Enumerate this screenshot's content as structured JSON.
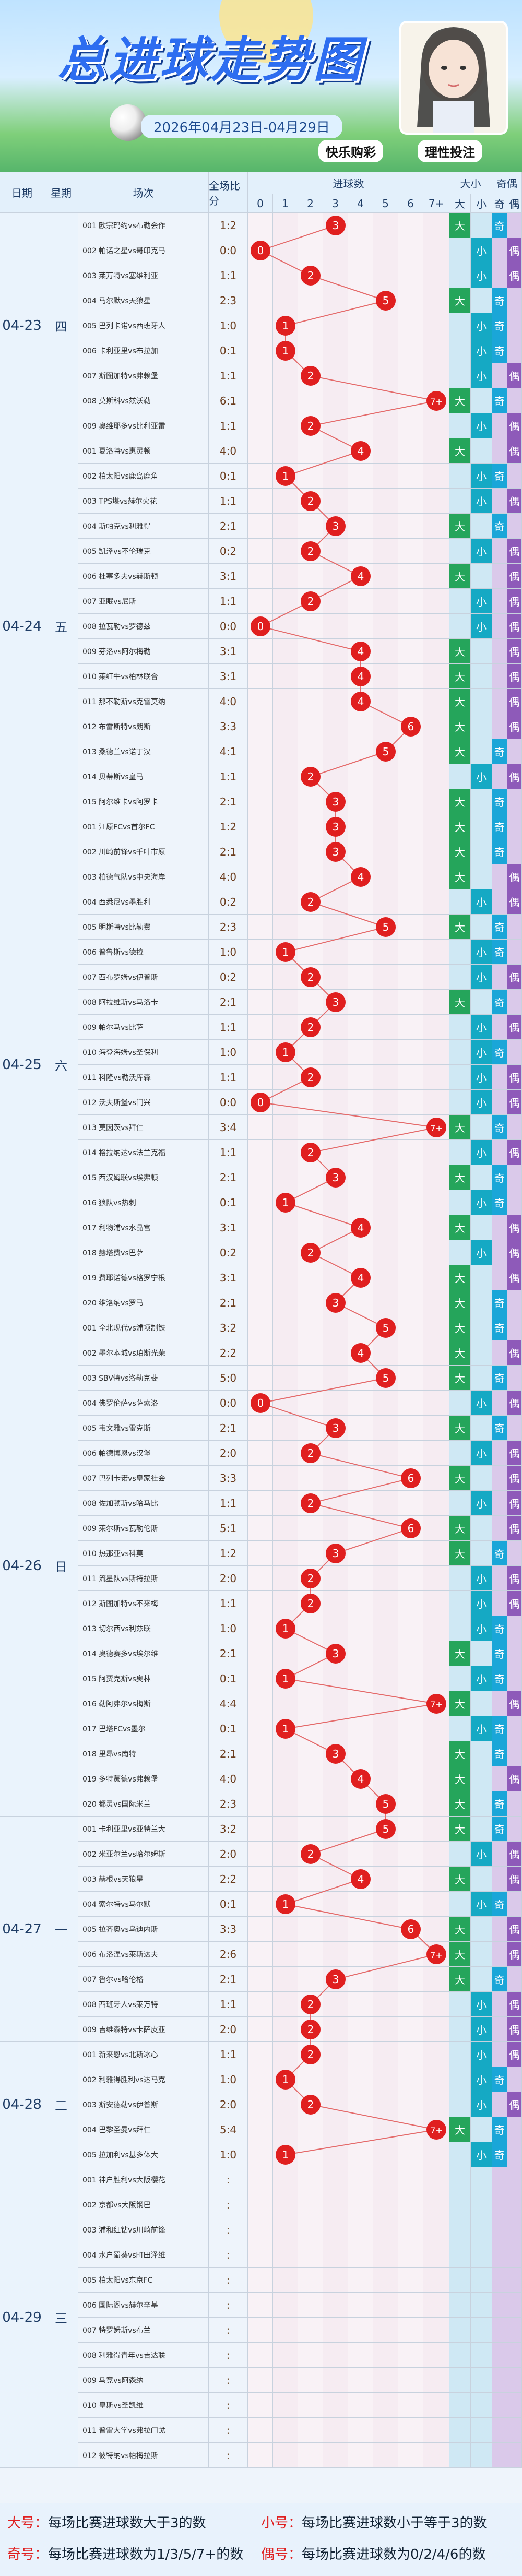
{
  "banner": {
    "title": "总进球走势图",
    "date_range": "2026年04月23日-04月29日",
    "brand_left": "快乐购彩",
    "brand_right": "理性投注",
    "colors": {
      "title": "#2d6df0",
      "ball": "#e01f1f",
      "line": "#e46a6a",
      "big": "#25a55b",
      "small": "#15a9c4",
      "odd": "#1aa6d8",
      "even": "#8e5ab9"
    }
  },
  "headers": {
    "date": "日期",
    "week": "星期",
    "match": "场次",
    "full_score": "全场比分",
    "goals": "进球数",
    "goal_cols": [
      "0",
      "1",
      "2",
      "3",
      "4",
      "5",
      "6",
      "7+"
    ],
    "bigsmall": "大小",
    "oddeven": "奇偶",
    "big": "大",
    "small": "小",
    "odd": "奇",
    "even": "偶"
  },
  "groups": [
    {
      "date": "04-23",
      "week": "四",
      "rows": 9
    },
    {
      "date": "04-24",
      "week": "五",
      "rows": 15
    },
    {
      "date": "04-25",
      "week": "六",
      "rows": 20
    },
    {
      "date": "04-26",
      "week": "日",
      "rows": 20
    },
    {
      "date": "04-27",
      "week": "一",
      "rows": 9
    },
    {
      "date": "04-28",
      "week": "二",
      "rows": 5
    },
    {
      "date": "04-29",
      "week": "三",
      "rows": 12
    }
  ],
  "chart_data": {
    "type": "table",
    "goal_categories": [
      "0",
      "1",
      "2",
      "3",
      "4",
      "5",
      "6",
      "7+"
    ],
    "matches": [
      {
        "m": "001 欧宗玛约vs布勒会作",
        "s": "1:2",
        "g": 3,
        "bs": "大",
        "oe": "奇"
      },
      {
        "m": "002 帕诺之星vs哥印克马",
        "s": "0:0",
        "g": 0,
        "bs": "小",
        "oe": "偶"
      },
      {
        "m": "003 莱万特vs塞维利亚",
        "s": "1:1",
        "g": 2,
        "bs": "小",
        "oe": "偶"
      },
      {
        "m": "004 马尔默vs天狼星",
        "s": "2:3",
        "g": 5,
        "bs": "大",
        "oe": "奇"
      },
      {
        "m": "005 巴列卡诺vs西班牙人",
        "s": "1:0",
        "g": 1,
        "bs": "小",
        "oe": "奇"
      },
      {
        "m": "006 卡利亚里vs布拉加",
        "s": "0:1",
        "g": 1,
        "bs": "小",
        "oe": "奇"
      },
      {
        "m": "007 斯图加特vs弗赖堡",
        "s": "1:1",
        "g": 2,
        "bs": "小",
        "oe": "偶"
      },
      {
        "m": "008 莫斯科vs兹沃勒",
        "s": "6:1",
        "g": 7,
        "bs": "大",
        "oe": "奇"
      },
      {
        "m": "009 奥维耶多vs比利亚雷",
        "s": "1:1",
        "g": 2,
        "bs": "小",
        "oe": "偶"
      },
      {
        "m": "001 夏洛特vs惠灵顿",
        "s": "4:0",
        "g": 4,
        "bs": "大",
        "oe": "偶"
      },
      {
        "m": "002 柏太阳vs鹿岛鹿角",
        "s": "0:1",
        "g": 1,
        "bs": "小",
        "oe": "奇"
      },
      {
        "m": "003 TPS堪vs赫尔火花",
        "s": "1:1",
        "g": 2,
        "bs": "小",
        "oe": "偶"
      },
      {
        "m": "004 斯帕克vs利雅得",
        "s": "2:1",
        "g": 3,
        "bs": "大",
        "oe": "奇"
      },
      {
        "m": "005 凯泽vs不伦瑞克",
        "s": "0:2",
        "g": 2,
        "bs": "小",
        "oe": "偶"
      },
      {
        "m": "006 杜塞多夫vs赫斯顿",
        "s": "3:1",
        "g": 4,
        "bs": "大",
        "oe": "偶"
      },
      {
        "m": "007 亚眠vs尼斯",
        "s": "1:1",
        "g": 2,
        "bs": "小",
        "oe": "偶"
      },
      {
        "m": "008 拉瓦勒vs罗德兹",
        "s": "0:0",
        "g": 0,
        "bs": "小",
        "oe": "偶"
      },
      {
        "m": "009 芬洛vs阿尔梅勒",
        "s": "3:1",
        "g": 4,
        "bs": "大",
        "oe": "偶"
      },
      {
        "m": "010 莱红牛vs柏林联合",
        "s": "3:1",
        "g": 4,
        "bs": "大",
        "oe": "偶"
      },
      {
        "m": "011 那不勒斯vs克雷莫纳",
        "s": "4:0",
        "g": 4,
        "bs": "大",
        "oe": "偶"
      },
      {
        "m": "012 布雷斯特vs朗斯",
        "s": "3:3",
        "g": 6,
        "bs": "大",
        "oe": "偶"
      },
      {
        "m": "013 桑德兰vs诺丁汉",
        "s": "4:1",
        "g": 5,
        "bs": "大",
        "oe": "奇"
      },
      {
        "m": "014 贝蒂斯vs皇马",
        "s": "1:1",
        "g": 2,
        "bs": "小",
        "oe": "偶"
      },
      {
        "m": "015 阿尔维卡vs阿罗卡",
        "s": "2:1",
        "g": 3,
        "bs": "大",
        "oe": "奇"
      },
      {
        "m": "001 江原FCvs首尔FC",
        "s": "1:2",
        "g": 3,
        "bs": "大",
        "oe": "奇"
      },
      {
        "m": "002 川崎前锋vs千叶市原",
        "s": "2:1",
        "g": 3,
        "bs": "大",
        "oe": "奇"
      },
      {
        "m": "003 柏德气队vs中央海岸",
        "s": "4:0",
        "g": 4,
        "bs": "大",
        "oe": "偶"
      },
      {
        "m": "004 西悉尼vs墨胜利",
        "s": "0:2",
        "g": 2,
        "bs": "小",
        "oe": "偶"
      },
      {
        "m": "005 明斯特vs比勒费",
        "s": "2:3",
        "g": 5,
        "bs": "大",
        "oe": "奇"
      },
      {
        "m": "006 普鲁斯vs德拉",
        "s": "1:0",
        "g": 1,
        "bs": "小",
        "oe": "奇"
      },
      {
        "m": "007 西布罗姆vs伊普斯",
        "s": "0:2",
        "g": 2,
        "bs": "小",
        "oe": "偶"
      },
      {
        "m": "008 阿拉维斯vs马洛卡",
        "s": "2:1",
        "g": 3,
        "bs": "大",
        "oe": "奇"
      },
      {
        "m": "009 帕尔马vs比萨",
        "s": "1:1",
        "g": 2,
        "bs": "小",
        "oe": "偶"
      },
      {
        "m": "010 海登海姆vs圣保利",
        "s": "1:0",
        "g": 1,
        "bs": "小",
        "oe": "奇"
      },
      {
        "m": "011 科隆vs勒沃库森",
        "s": "1:1",
        "g": 2,
        "bs": "小",
        "oe": "偶"
      },
      {
        "m": "012 沃夫斯堡vs门兴",
        "s": "0:0",
        "g": 0,
        "bs": "小",
        "oe": "偶"
      },
      {
        "m": "013 莫因茨vs拜仁",
        "s": "3:4",
        "g": 7,
        "bs": "大",
        "oe": "奇"
      },
      {
        "m": "014 格拉纳达vs法兰克福",
        "s": "1:1",
        "g": 2,
        "bs": "小",
        "oe": "偶"
      },
      {
        "m": "015 西汉姆联vs埃弗顿",
        "s": "2:1",
        "g": 3,
        "bs": "大",
        "oe": "奇"
      },
      {
        "m": "016 狼队vs热刺",
        "s": "0:1",
        "g": 1,
        "bs": "小",
        "oe": "奇"
      },
      {
        "m": "017 利物浦vs水晶宫",
        "s": "3:1",
        "g": 4,
        "bs": "大",
        "oe": "偶"
      },
      {
        "m": "018 赫塔费vs巴萨",
        "s": "0:2",
        "g": 2,
        "bs": "小",
        "oe": "偶"
      },
      {
        "m": "019 费耶诺德vs格罗宁根",
        "s": "3:1",
        "g": 4,
        "bs": "大",
        "oe": "偶"
      },
      {
        "m": "020 维洛纳vs罗马",
        "s": "2:1",
        "g": 3,
        "bs": "大",
        "oe": "奇"
      },
      {
        "m": "001 全北现代vs浦项制铁",
        "s": "3:2",
        "g": 5,
        "bs": "大",
        "oe": "奇"
      },
      {
        "m": "002 墨尔本城vs珀斯光荣",
        "s": "2:2",
        "g": 4,
        "bs": "大",
        "oe": "偶"
      },
      {
        "m": "003 SBV特vs洛勒克斐",
        "s": "5:0",
        "g": 5,
        "bs": "大",
        "oe": "奇"
      },
      {
        "m": "004 佛罗伦萨vs萨索洛",
        "s": "0:0",
        "g": 0,
        "bs": "小",
        "oe": "偶"
      },
      {
        "m": "005 韦文雅vs雷克斯",
        "s": "2:1",
        "g": 3,
        "bs": "大",
        "oe": "奇"
      },
      {
        "m": "006 帕德博恩vs汉堡",
        "s": "2:0",
        "g": 2,
        "bs": "小",
        "oe": "偶"
      },
      {
        "m": "007 巴列卡诺vs皇家社会",
        "s": "3:3",
        "g": 6,
        "bs": "大",
        "oe": "偶"
      },
      {
        "m": "008 佐加顿斯vs哈马比",
        "s": "1:1",
        "g": 2,
        "bs": "小",
        "oe": "偶"
      },
      {
        "m": "009 莱尔斯vs瓦勒伦斯",
        "s": "5:1",
        "g": 6,
        "bs": "大",
        "oe": "偶"
      },
      {
        "m": "010 热那亚vs科莫",
        "s": "1:2",
        "g": 3,
        "bs": "大",
        "oe": "奇"
      },
      {
        "m": "011 流星队vs斯特拉斯",
        "s": "2:0",
        "g": 2,
        "bs": "小",
        "oe": "偶"
      },
      {
        "m": "012 斯图加特vs不来梅",
        "s": "1:1",
        "g": 2,
        "bs": "小",
        "oe": "偶"
      },
      {
        "m": "013 切尔西vs利兹联",
        "s": "1:0",
        "g": 1,
        "bs": "小",
        "oe": "奇"
      },
      {
        "m": "014 奥德赛多vs埃尔维",
        "s": "2:1",
        "g": 3,
        "bs": "大",
        "oe": "奇"
      },
      {
        "m": "015 阿贾克斯vs奥林",
        "s": "0:1",
        "g": 1,
        "bs": "小",
        "oe": "奇"
      },
      {
        "m": "016 勒阿弗尔vs梅斯",
        "s": "4:4",
        "g": 7,
        "bs": "大",
        "oe": "偶"
      },
      {
        "m": "017 巴塔FCvs墨尔",
        "s": "0:1",
        "g": 1,
        "bs": "小",
        "oe": "奇"
      },
      {
        "m": "018 里昂vs南特",
        "s": "2:1",
        "g": 3,
        "bs": "大",
        "oe": "奇"
      },
      {
        "m": "019 多特蒙德vs弗赖堡",
        "s": "4:0",
        "g": 4,
        "bs": "大",
        "oe": "偶"
      },
      {
        "m": "020 都灵vs国际米兰",
        "s": "2:3",
        "g": 5,
        "bs": "大",
        "oe": "奇"
      },
      {
        "m": "001 卡利亚里vs亚特兰大",
        "s": "3:2",
        "g": 5,
        "bs": "大",
        "oe": "奇"
      },
      {
        "m": "002 米亚尔兰vs哈尔姆斯",
        "s": "2:0",
        "g": 2,
        "bs": "小",
        "oe": "偶"
      },
      {
        "m": "003 赫根vs天狼星",
        "s": "2:2",
        "g": 4,
        "bs": "大",
        "oe": "偶"
      },
      {
        "m": "004 索尔特vs马尔默",
        "s": "0:1",
        "g": 1,
        "bs": "小",
        "oe": "奇"
      },
      {
        "m": "005 拉齐奥vs乌迪内斯",
        "s": "3:3",
        "g": 6,
        "bs": "大",
        "oe": "偶"
      },
      {
        "m": "006 布洛涅vs莱斯达夫",
        "s": "2:6",
        "g": 7,
        "bs": "大",
        "oe": "偶"
      },
      {
        "m": "007 鲁尔vs哈伦格",
        "s": "2:1",
        "g": 3,
        "bs": "大",
        "oe": "奇"
      },
      {
        "m": "008 西班牙人vs莱万特",
        "s": "1:1",
        "g": 2,
        "bs": "小",
        "oe": "偶"
      },
      {
        "m": "009 吉维森特vs卡萨皮亚",
        "s": "2:0",
        "g": 2,
        "bs": "小",
        "oe": "偶"
      },
      {
        "m": "001 新来恩vs北斯冰心",
        "s": "1:1",
        "g": 2,
        "bs": "小",
        "oe": "偶"
      },
      {
        "m": "002 利雅得胜利vs达马克",
        "s": "1:0",
        "g": 1,
        "bs": "小",
        "oe": "奇"
      },
      {
        "m": "003 斯安德勒vs伊普斯",
        "s": "2:0",
        "g": 2,
        "bs": "小",
        "oe": "偶"
      },
      {
        "m": "004 巴黎圣曼vs拜仁",
        "s": "5:4",
        "g": 7,
        "bs": "大",
        "oe": "奇"
      },
      {
        "m": "005 拉加利vs基多体大",
        "s": "1:0",
        "g": 1,
        "bs": "小",
        "oe": "奇"
      },
      {
        "m": "001 神户胜利vs大阪樱花",
        "s": ":",
        "g": null,
        "bs": "",
        "oe": ""
      },
      {
        "m": "002 京都vs大阪钢巴",
        "s": ":",
        "g": null,
        "bs": "",
        "oe": ""
      },
      {
        "m": "003 浦和红钻vs川崎前锋",
        "s": ":",
        "g": null,
        "bs": "",
        "oe": ""
      },
      {
        "m": "004 水户蜀葵vs町田泽维",
        "s": ":",
        "g": null,
        "bs": "",
        "oe": ""
      },
      {
        "m": "005 柏太阳vs东京FC",
        "s": ":",
        "g": null,
        "bs": "",
        "oe": ""
      },
      {
        "m": "006 国际阁vs赫尔辛基",
        "s": ":",
        "g": null,
        "bs": "",
        "oe": ""
      },
      {
        "m": "007 特罗姆斯vs布兰",
        "s": ":",
        "g": null,
        "bs": "",
        "oe": ""
      },
      {
        "m": "008 利雅得青年vs吉达联",
        "s": ":",
        "g": null,
        "bs": "",
        "oe": ""
      },
      {
        "m": "009 马竞vs阿森纳",
        "s": ":",
        "g": null,
        "bs": "",
        "oe": ""
      },
      {
        "m": "010 皇斯vs圣凯维",
        "s": ":",
        "g": null,
        "bs": "",
        "oe": ""
      },
      {
        "m": "011 普雷大学vs弗拉门戈",
        "s": ":",
        "g": null,
        "bs": "",
        "oe": ""
      },
      {
        "m": "012 彼特纳vs帕梅拉斯",
        "s": ":",
        "g": null,
        "bs": "",
        "oe": ""
      }
    ]
  },
  "legend": {
    "big_label": "大号：",
    "big_text": "每场比赛进球数大于3的数",
    "small_label": "小号：",
    "small_text": "每场比赛进球数小于等于3的数",
    "odd_label": "奇号：",
    "odd_text": "每场比赛进球数为1/3/5/7+的数",
    "even_label": "偶号：",
    "even_text": "每场比赛进球数为0/2/4/6的数"
  }
}
